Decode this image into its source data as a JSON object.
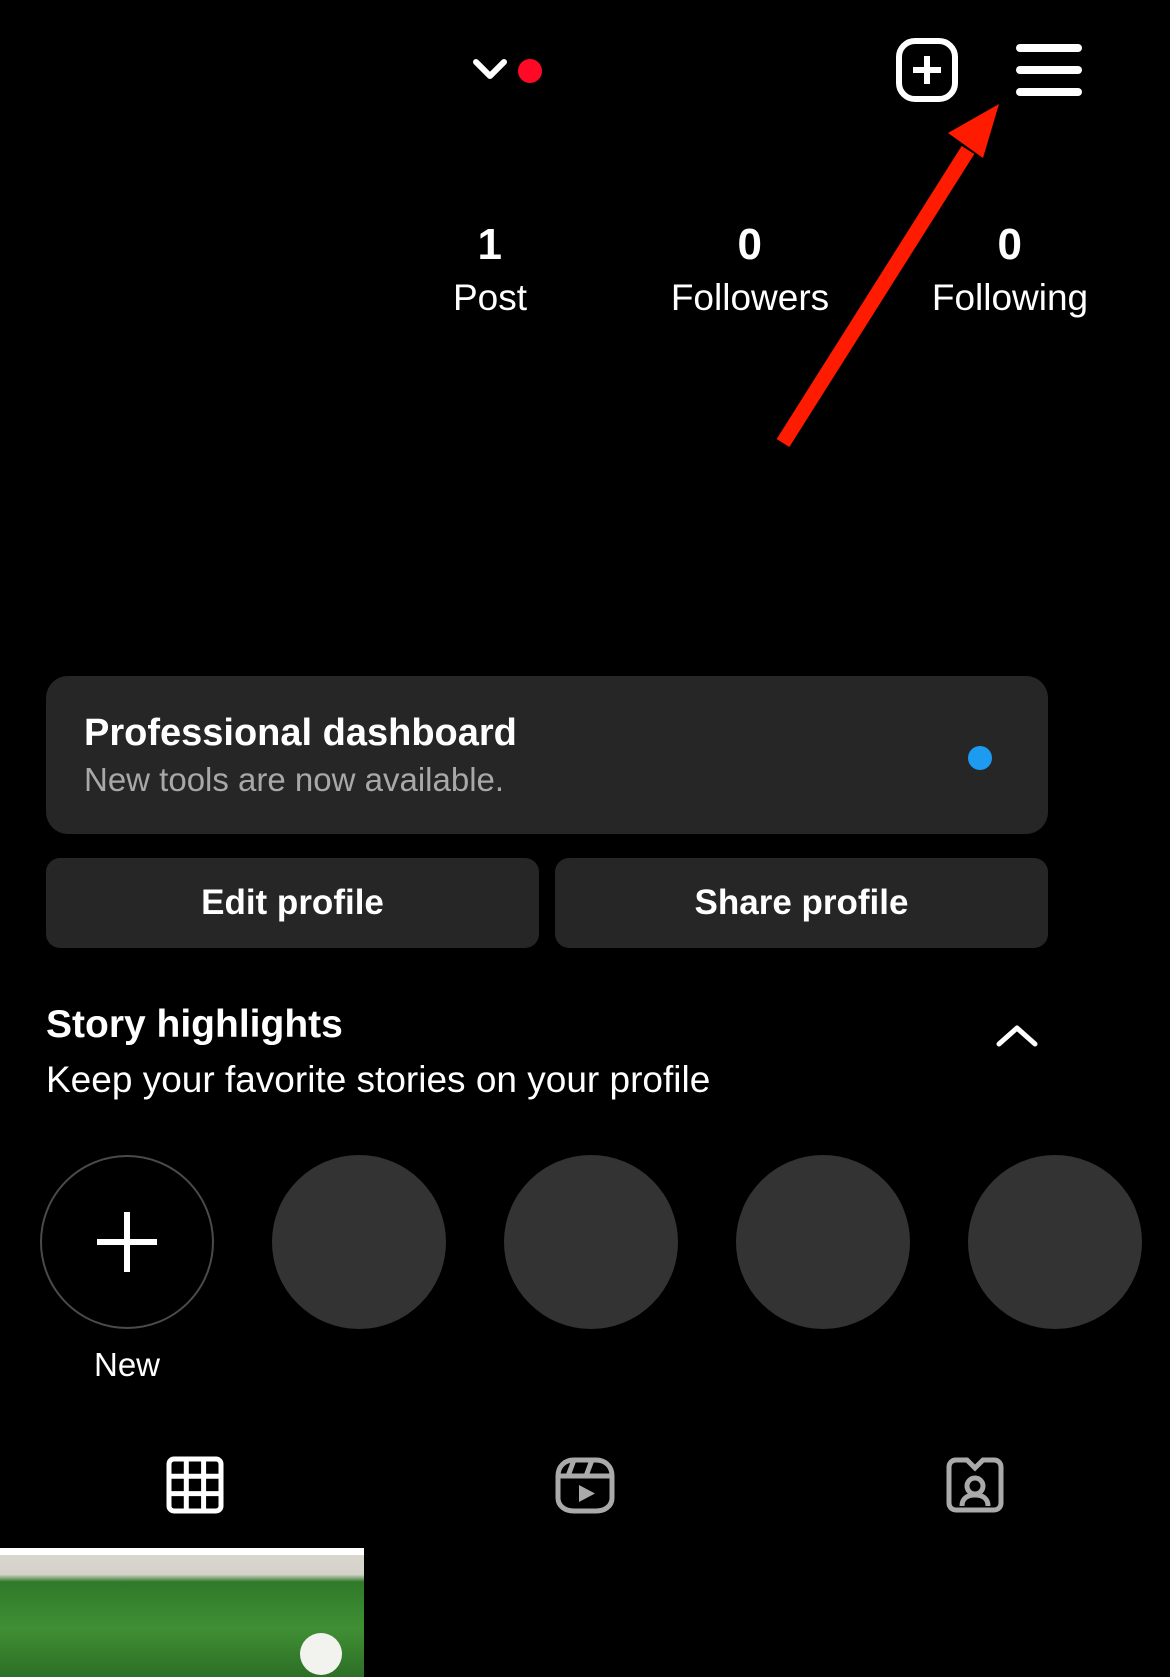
{
  "app": "instagram-profile",
  "topbar": {
    "chevron_icon": "chevron-down-icon",
    "notification_dot_color": "#FF0A26",
    "create_icon": "plus-square-icon",
    "menu_icon": "hamburger-menu-icon"
  },
  "annotation": {
    "arrow_color": "#FF1B00",
    "arrow_target": "hamburger-menu-icon"
  },
  "stats": [
    {
      "count": "1",
      "label": "Post"
    },
    {
      "count": "0",
      "label": "Followers"
    },
    {
      "count": "0",
      "label": "Following"
    }
  ],
  "dashboard": {
    "title": "Professional dashboard",
    "subtitle": "New tools are now available.",
    "badge_color": "#1D9BF0"
  },
  "actions": {
    "edit_profile": "Edit profile",
    "share_profile": "Share profile"
  },
  "story_highlights": {
    "title": "Story highlights",
    "subtitle": "Keep your favorite stories on your profile",
    "collapse_icon": "chevron-up-icon",
    "items": [
      {
        "label": "New",
        "type": "add"
      },
      {
        "label": "",
        "type": "placeholder"
      },
      {
        "label": "",
        "type": "placeholder"
      },
      {
        "label": "",
        "type": "placeholder"
      },
      {
        "label": "",
        "type": "placeholder"
      }
    ]
  },
  "tabs": [
    {
      "name": "grid",
      "icon": "grid-icon",
      "active": true
    },
    {
      "name": "reels",
      "icon": "reels-icon",
      "active": false
    },
    {
      "name": "tagged",
      "icon": "tagged-person-icon",
      "active": false
    }
  ]
}
